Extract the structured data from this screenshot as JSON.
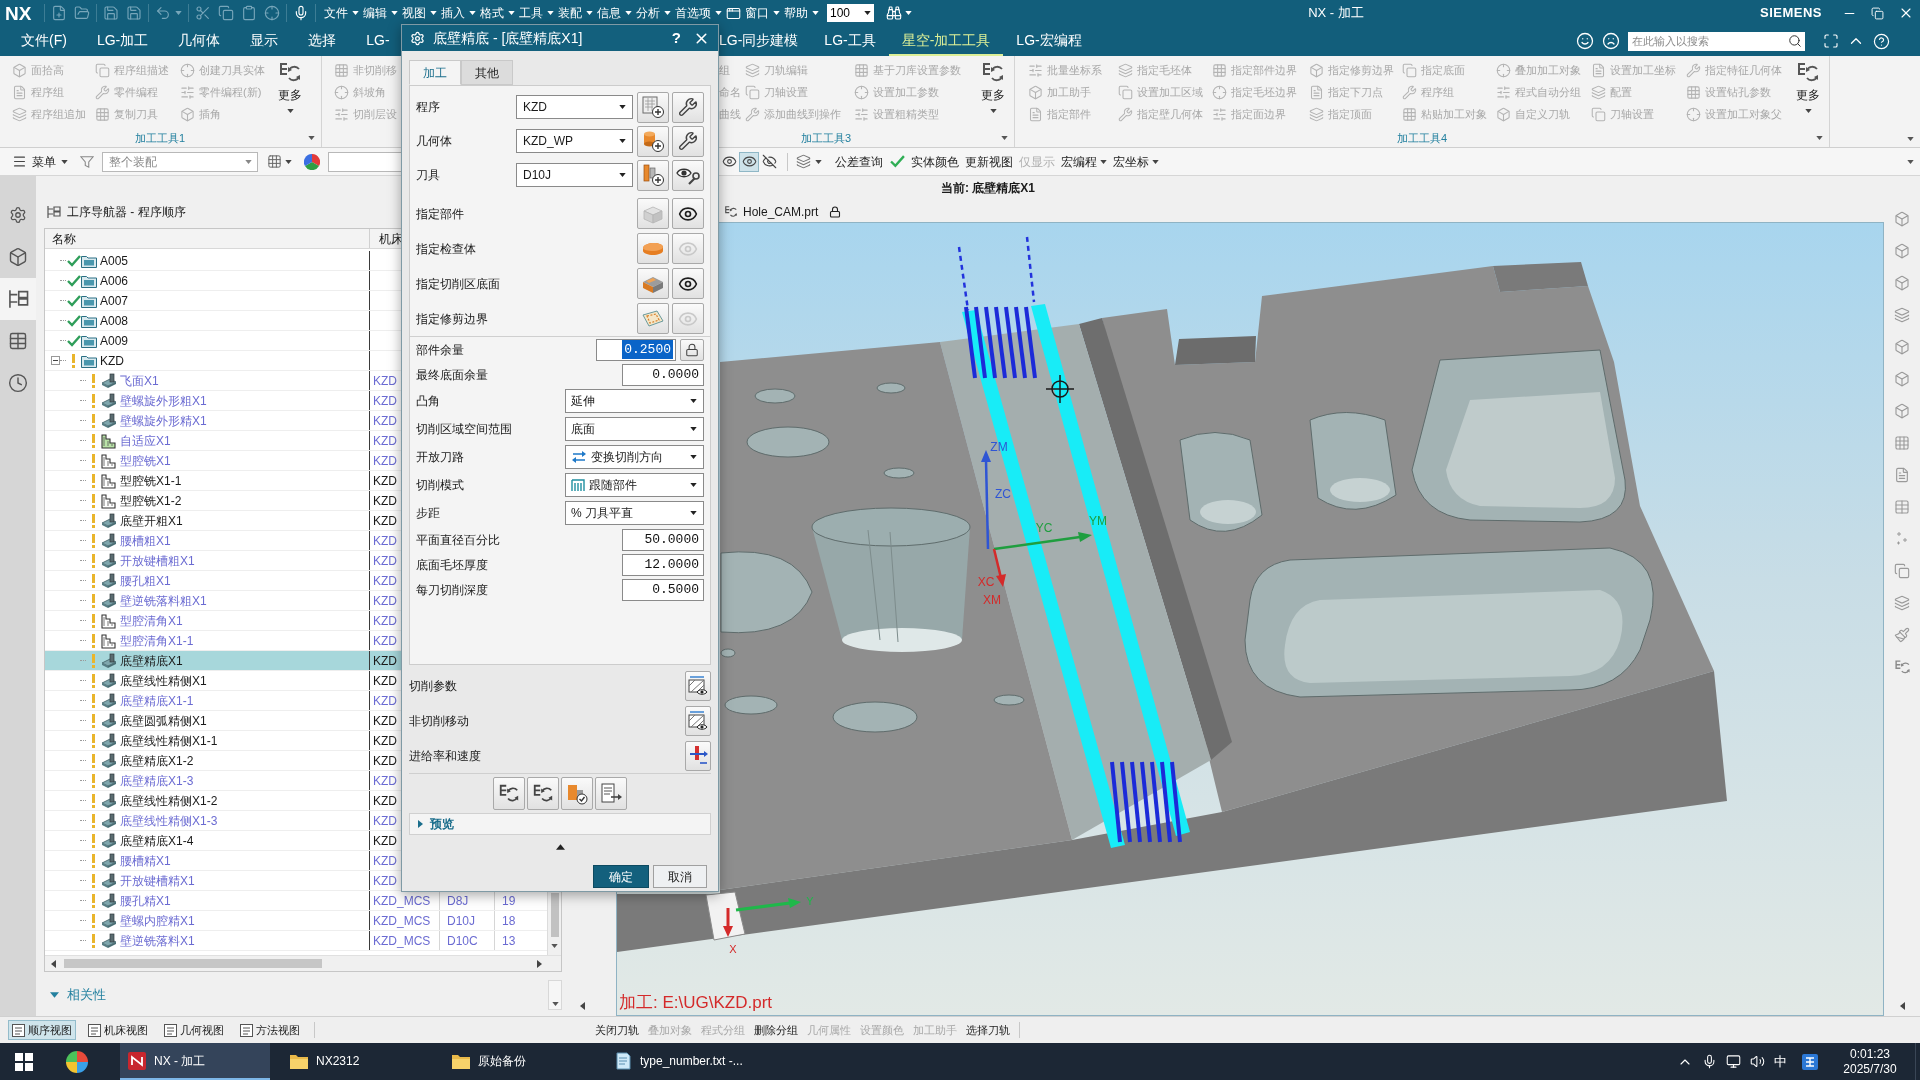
{
  "window": {
    "logo": "NX",
    "title": "NX - 加工",
    "brand": "SIEMENS"
  },
  "menu": [
    "文件",
    "编辑",
    "视图",
    "插入",
    "格式",
    "工具",
    "装配",
    "信息",
    "分析",
    "首选项",
    "窗口",
    "帮助"
  ],
  "zoom_box": {
    "value": "100"
  },
  "ribbon": {
    "tabs": [
      {
        "label": "文件(F)",
        "selected": false
      },
      {
        "label": "LG-加工",
        "selected": false
      },
      {
        "label": "几何体",
        "selected": false
      },
      {
        "label": "显示",
        "selected": false
      },
      {
        "label": "选择",
        "selected": false
      },
      {
        "label": "LG-",
        "selected": false
      },
      {
        "label": "LG-同步建模",
        "selected": false
      },
      {
        "label": "LG-工具",
        "selected": false
      },
      {
        "label": "星空-加工工具",
        "selected": true
      },
      {
        "label": "LG-宏编程",
        "selected": false
      }
    ],
    "search": {
      "placeholder": "在此输入以搜索"
    },
    "disabled": true,
    "groups": [
      {
        "label": "加工工具1",
        "columns": [
          [
            "面拾高",
            "程序组",
            "程序组追加"
          ],
          [
            "程序组描述",
            "零件编程",
            "复制刀具"
          ],
          [
            "创建刀具实体",
            "零件编程(新)",
            "插角"
          ]
        ],
        "more": "更多"
      },
      {
        "columns": [
          [
            "非切削移",
            "斜坡角",
            "切削层设"
          ]
        ]
      },
      {
        "label": "加工工具3",
        "columns": [
          [
            "刀轨编辑",
            "刀轴设置",
            "添加曲线到操作"
          ],
          [
            "基于刀库设置参数",
            "设置加工参数",
            "设置粗精类型"
          ]
        ],
        "more": "更多"
      },
      {
        "label": "加工工具4",
        "columns": [
          [
            "批量坐标系",
            "加工助手",
            "指定部件"
          ],
          [
            "指定毛坯体",
            "设置加工区域",
            "指定壁几何体"
          ],
          [
            "指定部件边界",
            "指定毛坯边界",
            "指定面边界"
          ],
          [
            "指定修剪边界",
            "指定下刀点",
            "指定顶面"
          ],
          [
            "指定底面",
            "程序组",
            "粘贴加工对象"
          ],
          [
            "叠加加工对象",
            "程式自动分组",
            "自定义刀轨"
          ],
          [
            "设置加工坐标",
            "配置",
            "刀轴设置"
          ],
          [
            "指定特征几何体",
            "设置钻孔参数",
            "设置加工对象父"
          ]
        ],
        "more": "更多"
      }
    ],
    "clipped_column": [
      "组",
      "命名",
      "曲线"
    ]
  },
  "toolbar": {
    "menu": "菜单",
    "assembly_filter": "整个装配",
    "toggles": [
      {
        "on": false
      },
      {
        "on": true
      },
      {
        "on": false
      }
    ],
    "commands": [
      {
        "label": "公差查询",
        "disabled": false,
        "dropdown": false
      },
      {
        "label": "实体颜色",
        "disabled": false,
        "dropdown": false
      },
      {
        "label": "更新视图",
        "disabled": false,
        "dropdown": false
      },
      {
        "label": "仅显示",
        "disabled": true,
        "dropdown": false
      },
      {
        "label": "宏编程",
        "disabled": false,
        "dropdown": true
      },
      {
        "label": "宏坐标",
        "disabled": false,
        "dropdown": true
      }
    ]
  },
  "current_operation": "当前: 底壁精底X1",
  "graphics_tab": {
    "title": "Hole_CAM.prt"
  },
  "resource_bar": [
    {
      "selected": false
    },
    {
      "selected": false
    },
    {
      "selected": true
    },
    {
      "selected": false
    },
    {
      "selected": false
    }
  ],
  "navigator": {
    "title": "工序导航器 - 程序顺序",
    "columns": [
      "名称",
      "机床"
    ],
    "nodes": [
      {
        "name": "A005",
        "complete": true,
        "selected": false
      },
      {
        "name": "A006",
        "complete": true,
        "selected": false
      },
      {
        "name": "A007",
        "complete": true,
        "selected": false
      },
      {
        "name": "A008",
        "complete": true,
        "selected": false
      },
      {
        "name": "A009",
        "complete": true,
        "selected": false
      },
      {
        "name": "KZD",
        "complete": false,
        "selected": false,
        "expanded": true,
        "children": [
          {
            "name": "飞面X1",
            "kind": "wall",
            "complete": false,
            "inactive": true,
            "selected": false,
            "machine": "KZD"
          },
          {
            "name": "壁螺旋外形粗X1",
            "kind": "wall",
            "complete": false,
            "inactive": true,
            "selected": false,
            "machine": "KZD"
          },
          {
            "name": "壁螺旋外形精X1",
            "kind": "wall",
            "complete": false,
            "inactive": true,
            "selected": false,
            "machine": "KZD"
          },
          {
            "name": "自适应X1",
            "kind": "adaptive",
            "complete": false,
            "inactive": true,
            "selected": false,
            "machine": "KZD"
          },
          {
            "name": "型腔铣X1",
            "kind": "cavity",
            "complete": false,
            "inactive": true,
            "selected": false,
            "machine": "KZD"
          },
          {
            "name": "型腔铣X1-1",
            "kind": "cavity",
            "complete": false,
            "inactive": false,
            "selected": false,
            "machine": "KZD"
          },
          {
            "name": "型腔铣X1-2",
            "kind": "cavity",
            "complete": false,
            "inactive": false,
            "selected": false,
            "machine": "KZD"
          },
          {
            "name": "底壁开粗X1",
            "kind": "wall",
            "complete": false,
            "inactive": false,
            "selected": false,
            "machine": "KZD"
          },
          {
            "name": "腰槽粗X1",
            "kind": "wall",
            "complete": false,
            "inactive": true,
            "selected": false,
            "machine": "KZD"
          },
          {
            "name": "开放键槽粗X1",
            "kind": "wall",
            "complete": false,
            "inactive": true,
            "selected": false,
            "machine": "KZD"
          },
          {
            "name": "腰孔粗X1",
            "kind": "wall",
            "complete": false,
            "inactive": true,
            "selected": false,
            "machine": "KZD"
          },
          {
            "name": "壁逆铣落料粗X1",
            "kind": "wall",
            "complete": false,
            "inactive": true,
            "selected": false,
            "machine": "KZD"
          },
          {
            "name": "型腔清角X1",
            "kind": "cavity",
            "complete": false,
            "inactive": true,
            "selected": false,
            "machine": "KZD"
          },
          {
            "name": "型腔清角X1-1",
            "kind": "cavity",
            "complete": false,
            "inactive": true,
            "selected": false,
            "machine": "KZD"
          },
          {
            "name": "底壁精底X1",
            "kind": "wall",
            "complete": false,
            "inactive": false,
            "selected": true,
            "machine": "KZD"
          },
          {
            "name": "底壁线性精侧X1",
            "kind": "wall",
            "complete": false,
            "inactive": false,
            "selected": false,
            "machine": "KZD"
          },
          {
            "name": "底壁精底X1-1",
            "kind": "wall",
            "complete": false,
            "inactive": true,
            "selected": false,
            "machine": "KZD"
          },
          {
            "name": "底壁圆弧精侧X1",
            "kind": "wall",
            "complete": false,
            "inactive": false,
            "selected": false,
            "machine": "KZD"
          },
          {
            "name": "底壁线性精侧X1-1",
            "kind": "wall",
            "complete": false,
            "inactive": false,
            "selected": false,
            "machine": "KZD"
          },
          {
            "name": "底壁精底X1-2",
            "kind": "wall",
            "complete": false,
            "inactive": false,
            "selected": false,
            "machine": "KZD"
          },
          {
            "name": "底壁精底X1-3",
            "kind": "wall",
            "complete": false,
            "inactive": true,
            "selected": false,
            "machine": "KZD"
          },
          {
            "name": "底壁线性精侧X1-2",
            "kind": "wall",
            "complete": false,
            "inactive": false,
            "selected": false,
            "machine": "KZD"
          },
          {
            "name": "底壁线性精侧X1-3",
            "kind": "wall",
            "complete": false,
            "inactive": true,
            "selected": false,
            "machine": "KZD"
          },
          {
            "name": "底壁精底X1-4",
            "kind": "wall",
            "complete": false,
            "inactive": false,
            "selected": false,
            "machine": "KZD"
          },
          {
            "name": "腰槽精X1",
            "kind": "wall",
            "complete": false,
            "inactive": true,
            "selected": false,
            "machine": "KZD"
          },
          {
            "name": "开放键槽精X1",
            "kind": "wall",
            "complete": false,
            "inactive": true,
            "selected": false,
            "machine": "KZD"
          },
          {
            "name": "腰孔精X1",
            "kind": "wall",
            "complete": false,
            "inactive": true,
            "selected": false,
            "machine": "KZD_MCS",
            "tool": "D8J",
            "order": "19"
          },
          {
            "name": "壁螺内腔精X1",
            "kind": "wall",
            "complete": false,
            "inactive": true,
            "selected": false,
            "machine": "KZD_MCS",
            "tool": "D10J",
            "order": "18"
          },
          {
            "name": "壁逆铣落料X1",
            "kind": "wall",
            "complete": false,
            "inactive": true,
            "selected": false,
            "machine": "KZD_MCS",
            "tool": "D10C",
            "order": "13"
          }
        ]
      }
    ]
  },
  "related_panel": "相关性",
  "view_tabs": [
    {
      "label": "顺序视图",
      "selected": true
    },
    {
      "label": "机床视图",
      "selected": false
    },
    {
      "label": "几何视图",
      "selected": false
    },
    {
      "label": "方法视图",
      "selected": false
    }
  ],
  "bottom_commands": [
    {
      "label": "关闭刀轨",
      "disabled": false
    },
    {
      "label": "叠加对象",
      "disabled": true
    },
    {
      "label": "程式分组",
      "disabled": true
    },
    {
      "label": "删除分组",
      "disabled": false
    },
    {
      "label": "几何属性",
      "disabled": true
    },
    {
      "label": "设置颜色",
      "disabled": true
    },
    {
      "label": "加工助手",
      "disabled": true
    },
    {
      "label": "选择刀轨",
      "disabled": false
    }
  ],
  "viewport": {
    "axis_labels": [
      "ZM",
      "ZC",
      "YC",
      "YM",
      "XC",
      "XM"
    ],
    "triad_labels": [
      "Y",
      "X"
    ],
    "status": "加工: E:\\UG\\KZD.prt"
  },
  "dialog": {
    "title": "底壁精底 - [底壁精底X1]",
    "help": "?",
    "tabs": [
      {
        "label": "加工",
        "selected": true
      },
      {
        "label": "其他",
        "selected": false
      }
    ],
    "geometry": [
      {
        "label": "程序",
        "value": "KZD"
      },
      {
        "label": "几何体",
        "value": "KZD_WP"
      },
      {
        "label": "刀具",
        "value": "D10J"
      }
    ],
    "specify": [
      {
        "label": "指定部件",
        "inherited": true,
        "display": true
      },
      {
        "label": "指定检查体",
        "inherited": false,
        "display": false
      },
      {
        "label": "指定切削区底面",
        "inherited": false,
        "display": true
      },
      {
        "label": "指定修剪边界",
        "inherited": false,
        "display": false
      }
    ],
    "params": [
      {
        "kind": "number",
        "label": "部件余量",
        "value": "0.2500",
        "highlighted": true,
        "lock": true
      },
      {
        "kind": "number",
        "label": "最终底面余量",
        "value": "0.0000",
        "highlighted": false
      },
      {
        "kind": "select",
        "label": "凸角",
        "value": "延伸"
      },
      {
        "kind": "select",
        "label": "切削区域空间范围",
        "value": "底面"
      },
      {
        "kind": "select",
        "label": "开放刀路",
        "value": "变换切削方向"
      },
      {
        "kind": "select",
        "label": "切削模式",
        "value": "跟随部件"
      },
      {
        "kind": "select",
        "label": "步距",
        "value": "% 刀具平直"
      },
      {
        "kind": "number",
        "label": "平面直径百分比",
        "value": "50.0000",
        "highlighted": false
      },
      {
        "kind": "number",
        "label": "底面毛坯厚度",
        "value": "12.0000",
        "highlighted": false
      },
      {
        "kind": "number",
        "label": "每刀切削深度",
        "value": "0.5000",
        "highlighted": false
      }
    ],
    "settings": [
      "切削参数",
      "非切削移动",
      "进给率和速度"
    ],
    "preview": {
      "label": "预览",
      "expanded": false
    },
    "buttons": [
      {
        "label": "确定",
        "kind": "primary"
      },
      {
        "label": "取消",
        "kind": "secondary"
      }
    ]
  },
  "taskbar": {
    "apps": [
      {
        "label": "NX - 加工",
        "kind": "nx",
        "active": true
      },
      {
        "label": "NX2312",
        "kind": "folder",
        "active": false
      },
      {
        "label": "原始备份",
        "kind": "folder",
        "active": false
      },
      {
        "label": "type_number.txt -...",
        "kind": "notepad",
        "active": false
      }
    ],
    "ime": "中",
    "time": "0:01:23",
    "date": "2025/7/30"
  }
}
